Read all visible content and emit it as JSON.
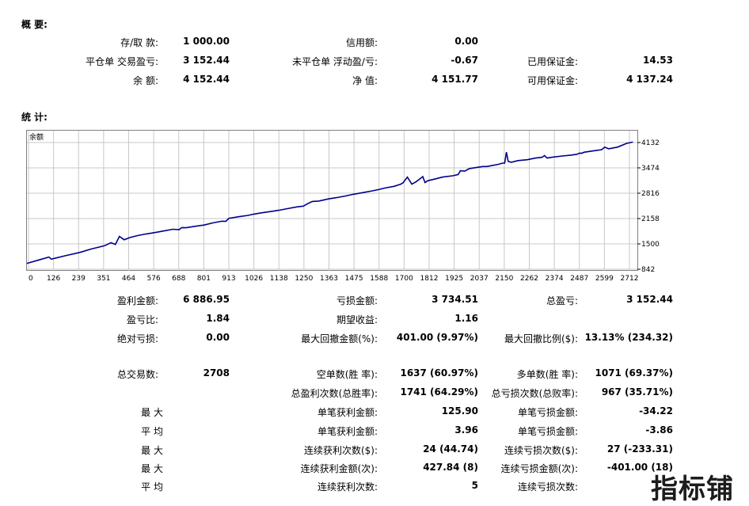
{
  "summary": {
    "title": "概 要:",
    "deposit_label": "存/取 款:",
    "deposit_value": "1 000.00",
    "credit_label": "信用额:",
    "credit_value": "0.00",
    "closed_pl_label": "平仓单 交易盈亏:",
    "closed_pl_value": "3 152.44",
    "floating_pl_label": "未平仓单 浮动盈/亏:",
    "floating_pl_value": "-0.67",
    "margin_label": "已用保证金:",
    "margin_value": "14.53",
    "balance_label": "余 额:",
    "balance_value": "4 152.44",
    "equity_label": "净 值:",
    "equity_value": "4 151.77",
    "free_margin_label": "可用保证金:",
    "free_margin_value": "4 137.24"
  },
  "stats": {
    "title": "统 计:",
    "rows": [
      {
        "l1": "盈利金额:",
        "v1": "6 886.95",
        "l2": "亏损金额:",
        "v2": "3 734.51",
        "l3": "总盈亏:",
        "v3": "3 152.44"
      },
      {
        "l1": "盈亏比:",
        "v1": "1.84",
        "l2": "期望收益:",
        "v2": "1.16",
        "l3": "",
        "v3": ""
      },
      {
        "l1": "绝对亏损:",
        "v1": "0.00",
        "l2": "最大回撤金额(%):",
        "v2": "401.00 (9.97%)",
        "l3": "最大回撤比例($):",
        "v3": "13.13% (234.32)"
      },
      {
        "l1": "总交易数:",
        "v1": "2708",
        "l2": "空单数(胜 率):",
        "v2": "1637 (60.97%)",
        "l3": "多单数(胜 率):",
        "v3": "1071 (69.37%)"
      },
      {
        "l1": "",
        "v1": "",
        "l2": "总盈利次数(总胜率):",
        "v2": "1741 (64.29%)",
        "l3": "总亏损次数(总败率):",
        "v3": "967 (35.71%)"
      },
      {
        "l1": "最 大",
        "v1": "",
        "l2": "单笔获利金额:",
        "v2": "125.90",
        "l3": "单笔亏损金额:",
        "v3": "-34.22"
      },
      {
        "l1": "平 均",
        "v1": "",
        "l2": "单笔获利金额:",
        "v2": "3.96",
        "l3": "单笔亏损金额:",
        "v3": "-3.86"
      },
      {
        "l1": "最 大",
        "v1": "",
        "l2": "连续获利次数($):",
        "v2": "24 (44.74)",
        "l3": "连续亏损次数($):",
        "v3": "27 (-233.31)"
      },
      {
        "l1": "最 大",
        "v1": "",
        "l2": "连续获利金额(次):",
        "v2": "427.84 (8)",
        "l3": "连续亏损金额(次):",
        "v3": "-401.00 (18)"
      },
      {
        "l1": "平 均",
        "v1": "",
        "l2": "连续获利次数:",
        "v2": "5",
        "l3": "连续亏损次数:",
        "v3": ""
      }
    ]
  },
  "watermark": "指标铺",
  "chart_data": {
    "type": "line",
    "title": "余额",
    "x_ticks": [
      "0",
      "126",
      "239",
      "351",
      "464",
      "576",
      "688",
      "801",
      "913",
      "1026",
      "1138",
      "1250",
      "1363",
      "1475",
      "1588",
      "1700",
      "1812",
      "1925",
      "2037",
      "2150",
      "2262",
      "2374",
      "2487",
      "2599",
      "2712"
    ],
    "y_ticks": [
      "4132",
      "3474",
      "2816",
      "2158",
      "1500",
      "842"
    ],
    "xlim": [
      0,
      2760
    ],
    "ylim": [
      842,
      4132
    ],
    "series": [
      {
        "color": "#00008b",
        "x": [
          0,
          60,
          100,
          110,
          126,
          180,
          239,
          290,
          351,
          380,
          400,
          418,
          440,
          464,
          500,
          540,
          576,
          620,
          660,
          688,
          700,
          720,
          760,
          801,
          840,
          880,
          900,
          913,
          960,
          1000,
          1026,
          1060,
          1100,
          1138,
          1180,
          1220,
          1250,
          1270,
          1290,
          1320,
          1363,
          1400,
          1440,
          1475,
          1520,
          1560,
          1588,
          1620,
          1660,
          1690,
          1700,
          1720,
          1740,
          1760,
          1790,
          1800,
          1812,
          1850,
          1880,
          1925,
          1950,
          1960,
          1980,
          2000,
          2037,
          2060,
          2080,
          2100,
          2130,
          2150,
          2160,
          2168,
          2176,
          2190,
          2220,
          2262,
          2300,
          2330,
          2340,
          2352,
          2374,
          2420,
          2460,
          2487,
          2500,
          2506,
          2520,
          2560,
          2599,
          2612,
          2630,
          2670,
          2712,
          2740
        ],
        "y": [
          1000,
          1090,
          1150,
          1100,
          1120,
          1190,
          1260,
          1340,
          1420,
          1490,
          1450,
          1640,
          1560,
          1610,
          1660,
          1700,
          1730,
          1770,
          1810,
          1800,
          1850,
          1845,
          1880,
          1910,
          1960,
          2000,
          2000,
          2070,
          2110,
          2140,
          2170,
          2200,
          2230,
          2260,
          2300,
          2340,
          2360,
          2420,
          2470,
          2480,
          2530,
          2560,
          2600,
          2640,
          2680,
          2720,
          2750,
          2790,
          2830,
          2880,
          2910,
          3050,
          2880,
          2940,
          3060,
          2920,
          2960,
          3010,
          3050,
          3080,
          3110,
          3200,
          3190,
          3250,
          3280,
          3300,
          3300,
          3320,
          3350,
          3380,
          3380,
          3640,
          3420,
          3400,
          3440,
          3460,
          3500,
          3520,
          3560,
          3500,
          3520,
          3550,
          3570,
          3590,
          3620,
          3610,
          3640,
          3670,
          3700,
          3760,
          3720,
          3760,
          3850,
          3880
        ]
      }
    ]
  }
}
